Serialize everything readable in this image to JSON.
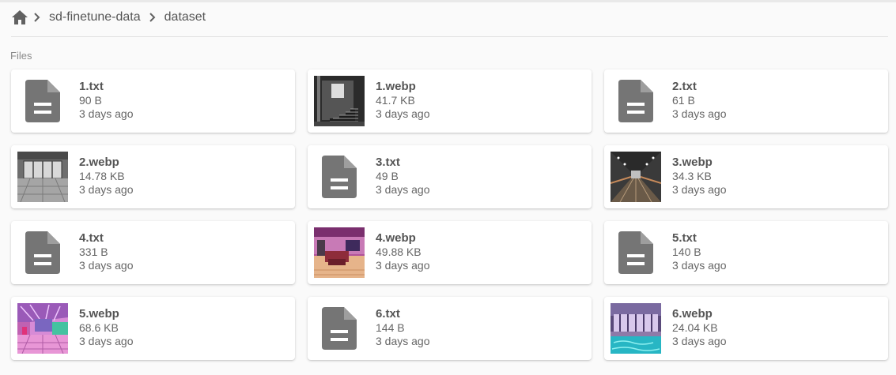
{
  "breadcrumb": {
    "home_icon": "home-icon",
    "items": [
      {
        "label": "sd-finetune-data"
      },
      {
        "label": "dataset"
      }
    ]
  },
  "section_label": "Files",
  "files": [
    {
      "name": "1.txt",
      "size": "90 B",
      "date": "3 days ago",
      "kind": "text",
      "thumb": "file-document-icon"
    },
    {
      "name": "1.webp",
      "size": "41.7 KB",
      "date": "3 days ago",
      "kind": "image",
      "thumb": "stairs-photo-thumbnail"
    },
    {
      "name": "2.txt",
      "size": "61 B",
      "date": "3 days ago",
      "kind": "text",
      "thumb": "file-document-icon"
    },
    {
      "name": "2.webp",
      "size": "14.78 KB",
      "date": "3 days ago",
      "kind": "image",
      "thumb": "empty-room-photo-thumbnail"
    },
    {
      "name": "3.txt",
      "size": "49 B",
      "date": "3 days ago",
      "kind": "text",
      "thumb": "file-document-icon"
    },
    {
      "name": "3.webp",
      "size": "34.3 KB",
      "date": "3 days ago",
      "kind": "image",
      "thumb": "corridor-photo-thumbnail"
    },
    {
      "name": "4.txt",
      "size": "331 B",
      "date": "3 days ago",
      "kind": "text",
      "thumb": "file-document-icon"
    },
    {
      "name": "4.webp",
      "size": "49.88 KB",
      "date": "3 days ago",
      "kind": "image",
      "thumb": "pink-lounge-photo-thumbnail"
    },
    {
      "name": "5.txt",
      "size": "140 B",
      "date": "3 days ago",
      "kind": "text",
      "thumb": "file-document-icon"
    },
    {
      "name": "5.webp",
      "size": "68.6 KB",
      "date": "3 days ago",
      "kind": "image",
      "thumb": "neon-hall-photo-thumbnail"
    },
    {
      "name": "6.txt",
      "size": "144 B",
      "date": "3 days ago",
      "kind": "text",
      "thumb": "file-document-icon"
    },
    {
      "name": "6.webp",
      "size": "24.04 KB",
      "date": "3 days ago",
      "kind": "image",
      "thumb": "pool-room-photo-thumbnail"
    }
  ]
}
